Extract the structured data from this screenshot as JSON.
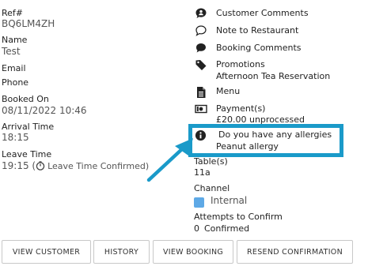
{
  "left": {
    "ref_label": "Ref#",
    "ref_value": "BQ6LM4ZH",
    "name_label": "Name",
    "name_value": "Test",
    "email_label": "Email",
    "phone_label": "Phone",
    "booked_on_label": "Booked On",
    "booked_on_value": "08/11/2022 10:46",
    "arrival_label": "Arrival Time",
    "arrival_value": "18:15",
    "leave_label": "Leave Time",
    "leave_value": "19:15 (",
    "leave_confirmed": "Leave Time Confirmed)"
  },
  "right": {
    "customer_comments": "Customer Comments",
    "note_to_restaurant": "Note to Restaurant",
    "booking_comments": "Booking Comments",
    "promotions_label": "Promotions",
    "promotions_value": "Afternoon Tea Reservation",
    "menu_label": "Menu",
    "payments_label": "Payment(s)",
    "payments_value": "£20.00 unprocessed",
    "allergies_label": "Do you have any allergies",
    "allergies_value": "Peanut allergy",
    "tables_label": "Table(s)",
    "tables_value": "11a",
    "channel_label": "Channel",
    "channel_value": "Internal",
    "attempts_label": "Attempts to Confirm",
    "attempts_value": "0",
    "attempts_status": "Confirmed"
  },
  "buttons": {
    "view_customer": "VIEW CUSTOMER",
    "history": "HISTORY",
    "view_booking": "VIEW BOOKING",
    "resend_confirmation": "RESEND CONFIRMATION"
  },
  "colors": {
    "callout": "#1a9ac9",
    "channel_internal": "#5ea9e6"
  },
  "icons": [
    "user-comment-icon",
    "speech-bubble-icon",
    "chat-bubble-icon",
    "tag-icon",
    "document-icon",
    "money-icon",
    "info-icon",
    "clock-icon",
    "arrow-pointer-icon"
  ]
}
